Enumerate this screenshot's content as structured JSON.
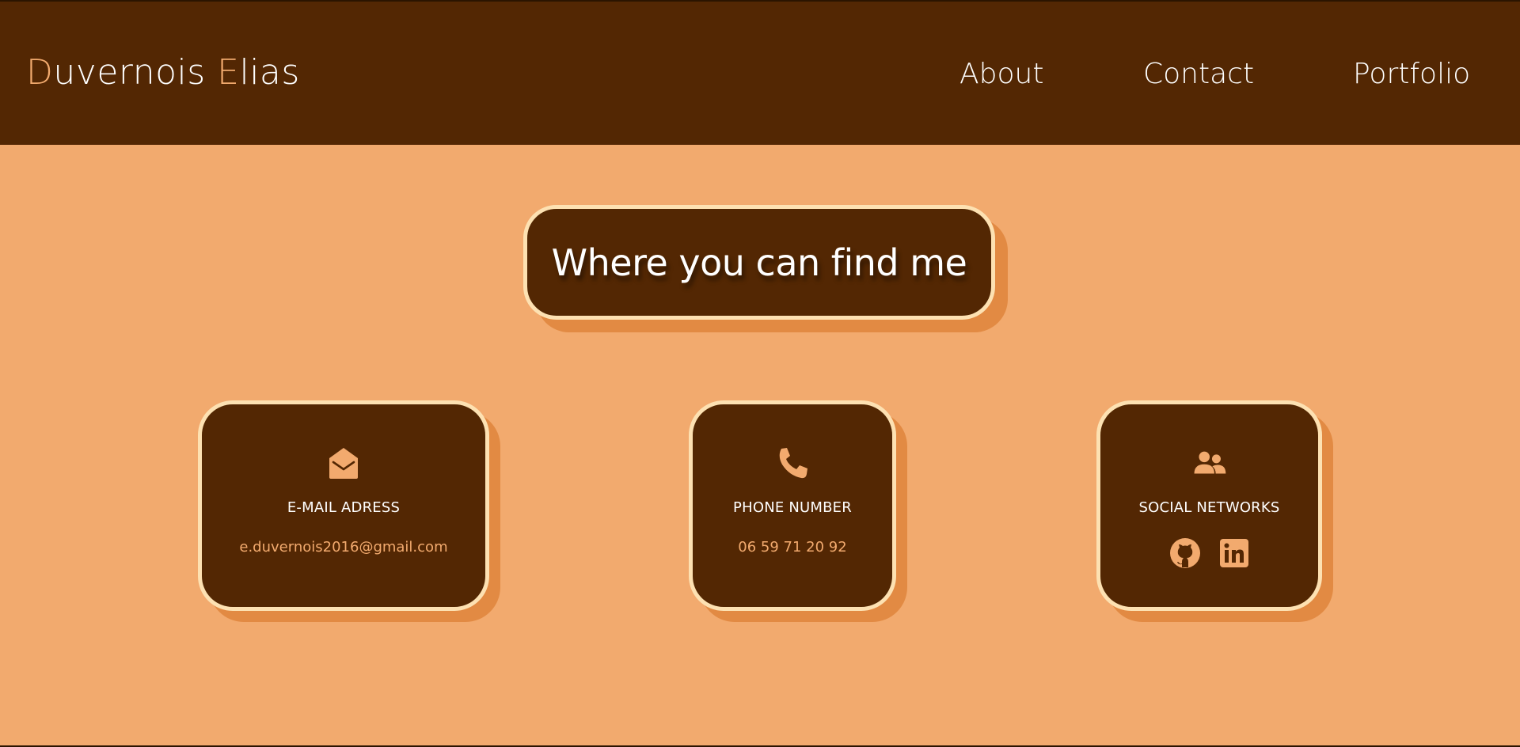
{
  "header": {
    "logo": {
      "first_initial": "D",
      "first_rest": "uvernois ",
      "last_initial": "E",
      "last_rest": "lias"
    },
    "nav": [
      {
        "label": "About"
      },
      {
        "label": "Contact"
      },
      {
        "label": "Portfolio"
      }
    ]
  },
  "main": {
    "title": "Where you can find me",
    "cards": {
      "email": {
        "icon": "envelope-open-icon",
        "label": "E-MAIL ADRESS",
        "value": "e.duvernois2016@gmail.com"
      },
      "phone": {
        "icon": "phone-icon",
        "label": "PHONE NUMBER",
        "value": "06 59 71 20 92"
      },
      "social": {
        "icon": "users-icon",
        "label": "SOCIAL NETWORKS",
        "links": [
          {
            "icon": "github-icon"
          },
          {
            "icon": "linkedin-icon"
          }
        ]
      }
    }
  },
  "colors": {
    "background": "#f2aa6e",
    "dark_brown": "#532703",
    "accent": "#f2aa6e",
    "border_cream": "#fde1b2",
    "shadow": "#e28a43",
    "text": "#ffffff"
  }
}
